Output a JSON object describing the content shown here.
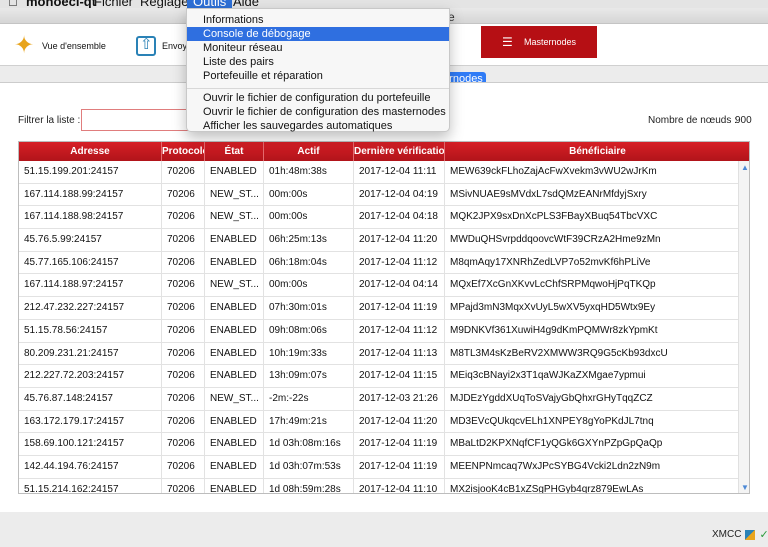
{
  "menubar": {
    "app": "monoeci-qt",
    "items": [
      "Fichier",
      "Réglages",
      "Outils",
      "Aide"
    ]
  },
  "window": {
    "title": "ille"
  },
  "toolbar": {
    "overview": "Vue d'ensemble",
    "send": "Envoyer",
    "masternodes": "Masternodes"
  },
  "tabs": {
    "active": "rnodes"
  },
  "filter": {
    "label": "Filtrer la liste :",
    "value": ""
  },
  "node_count": {
    "label": "Nombre de nœuds :",
    "value": "900"
  },
  "table": {
    "headers": [
      "Adresse",
      "Protocole",
      "État",
      "Actif",
      "Dernière vérification",
      "Bénéficiaire"
    ],
    "rows": [
      [
        "51.15.199.201:24157",
        "70206",
        "ENABLED",
        "01h:48m:38s",
        "2017-12-04 11:11",
        "MEW639ckFLhoZajAcFwXvekm3vWU2wJrKm"
      ],
      [
        "167.114.188.99:24157",
        "70206",
        "NEW_ST...",
        "00m:00s",
        "2017-12-04 04:19",
        "MSivNUAE9sMVdxL7sdQMzEANrMfdyjSxry"
      ],
      [
        "167.114.188.98:24157",
        "70206",
        "NEW_ST...",
        "00m:00s",
        "2017-12-04 04:18",
        "MQK2JPX9sxDnXcPLS3FBayXBuq54TbcVXC"
      ],
      [
        "45.76.5.99:24157",
        "70206",
        "ENABLED",
        "06h:25m:13s",
        "2017-12-04 11:20",
        "MWDuQHSvrpddqoovcWtF39CRzA2Hme9zMn"
      ],
      [
        "45.77.165.106:24157",
        "70206",
        "ENABLED",
        "06h:18m:04s",
        "2017-12-04 11:12",
        "M8qmAqy17XNRhZedLVP7o52mvKf6hPLiVe"
      ],
      [
        "167.114.188.97:24157",
        "70206",
        "NEW_ST...",
        "00m:00s",
        "2017-12-04 04:14",
        "MQxEf7XcGnXKvvLcChfSRPMqwoHjPqTKQp"
      ],
      [
        "212.47.232.227:24157",
        "70206",
        "ENABLED",
        "07h:30m:01s",
        "2017-12-04 11:19",
        "MPajd3mN3MqxXvUyL5wXV5yxqHD5Wtx9Ey"
      ],
      [
        "51.15.78.56:24157",
        "70206",
        "ENABLED",
        "09h:08m:06s",
        "2017-12-04 11:12",
        "M9DNKVf361XuwiH4g9dKmPQMWr8zkYpmKt"
      ],
      [
        "80.209.231.21:24157",
        "70206",
        "ENABLED",
        "10h:19m:33s",
        "2017-12-04 11:13",
        "M8TL3M4sKzBeRV2XMWW3RQ9G5cKb93dxcU"
      ],
      [
        "212.227.72.203:24157",
        "70206",
        "ENABLED",
        "13h:09m:07s",
        "2017-12-04 11:15",
        "MEiq3cBNayi2x3T1qaWJKaZXMgae7ypmui"
      ],
      [
        "45.76.87.148:24157",
        "70206",
        "NEW_ST...",
        "-2m:-22s",
        "2017-12-03 21:26",
        "MJDEzYgddXUqToSVajyGbQhxrGHyTqqZCZ"
      ],
      [
        "163.172.179.17:24157",
        "70206",
        "ENABLED",
        "17h:49m:21s",
        "2017-12-04 11:20",
        "MD3EVcQUkqcvELh1XNPEY8gYoPKdJL7tnq"
      ],
      [
        "158.69.100.121:24157",
        "70206",
        "ENABLED",
        "1d 03h:08m:16s",
        "2017-12-04 11:19",
        "MBaLtD2KPXNqfCF1yQGk6GXYnPZpGpQaQp"
      ],
      [
        "142.44.194.76:24157",
        "70206",
        "ENABLED",
        "1d 03h:07m:53s",
        "2017-12-04 11:19",
        "MEENPNmcaq7WxJPcSYBG4Vcki2Ldn2zN9m"
      ],
      [
        "51.15.214.162:24157",
        "70206",
        "ENABLED",
        "1d 08h:59m:28s",
        "2017-12-04 11:10",
        "MX2isjooK4cB1xZSgPHGyb4qrz879EwLAs"
      ]
    ]
  },
  "footer": {
    "brand": "XMCC"
  },
  "menu": {
    "items": [
      "Informations",
      "Console de débogage",
      "Moniteur réseau",
      "Liste des pairs",
      "Portefeuille et réparation",
      "Ouvrir le fichier de configuration du portefeuille",
      "Ouvrir le fichier de configuration des masternodes",
      "Afficher les sauvegardes automatiques"
    ],
    "selected_index": 1
  },
  "colors": {
    "header_red": "#c0161c",
    "accent_blue": "#2f6fe0",
    "masternode_red": "#b60f14"
  }
}
